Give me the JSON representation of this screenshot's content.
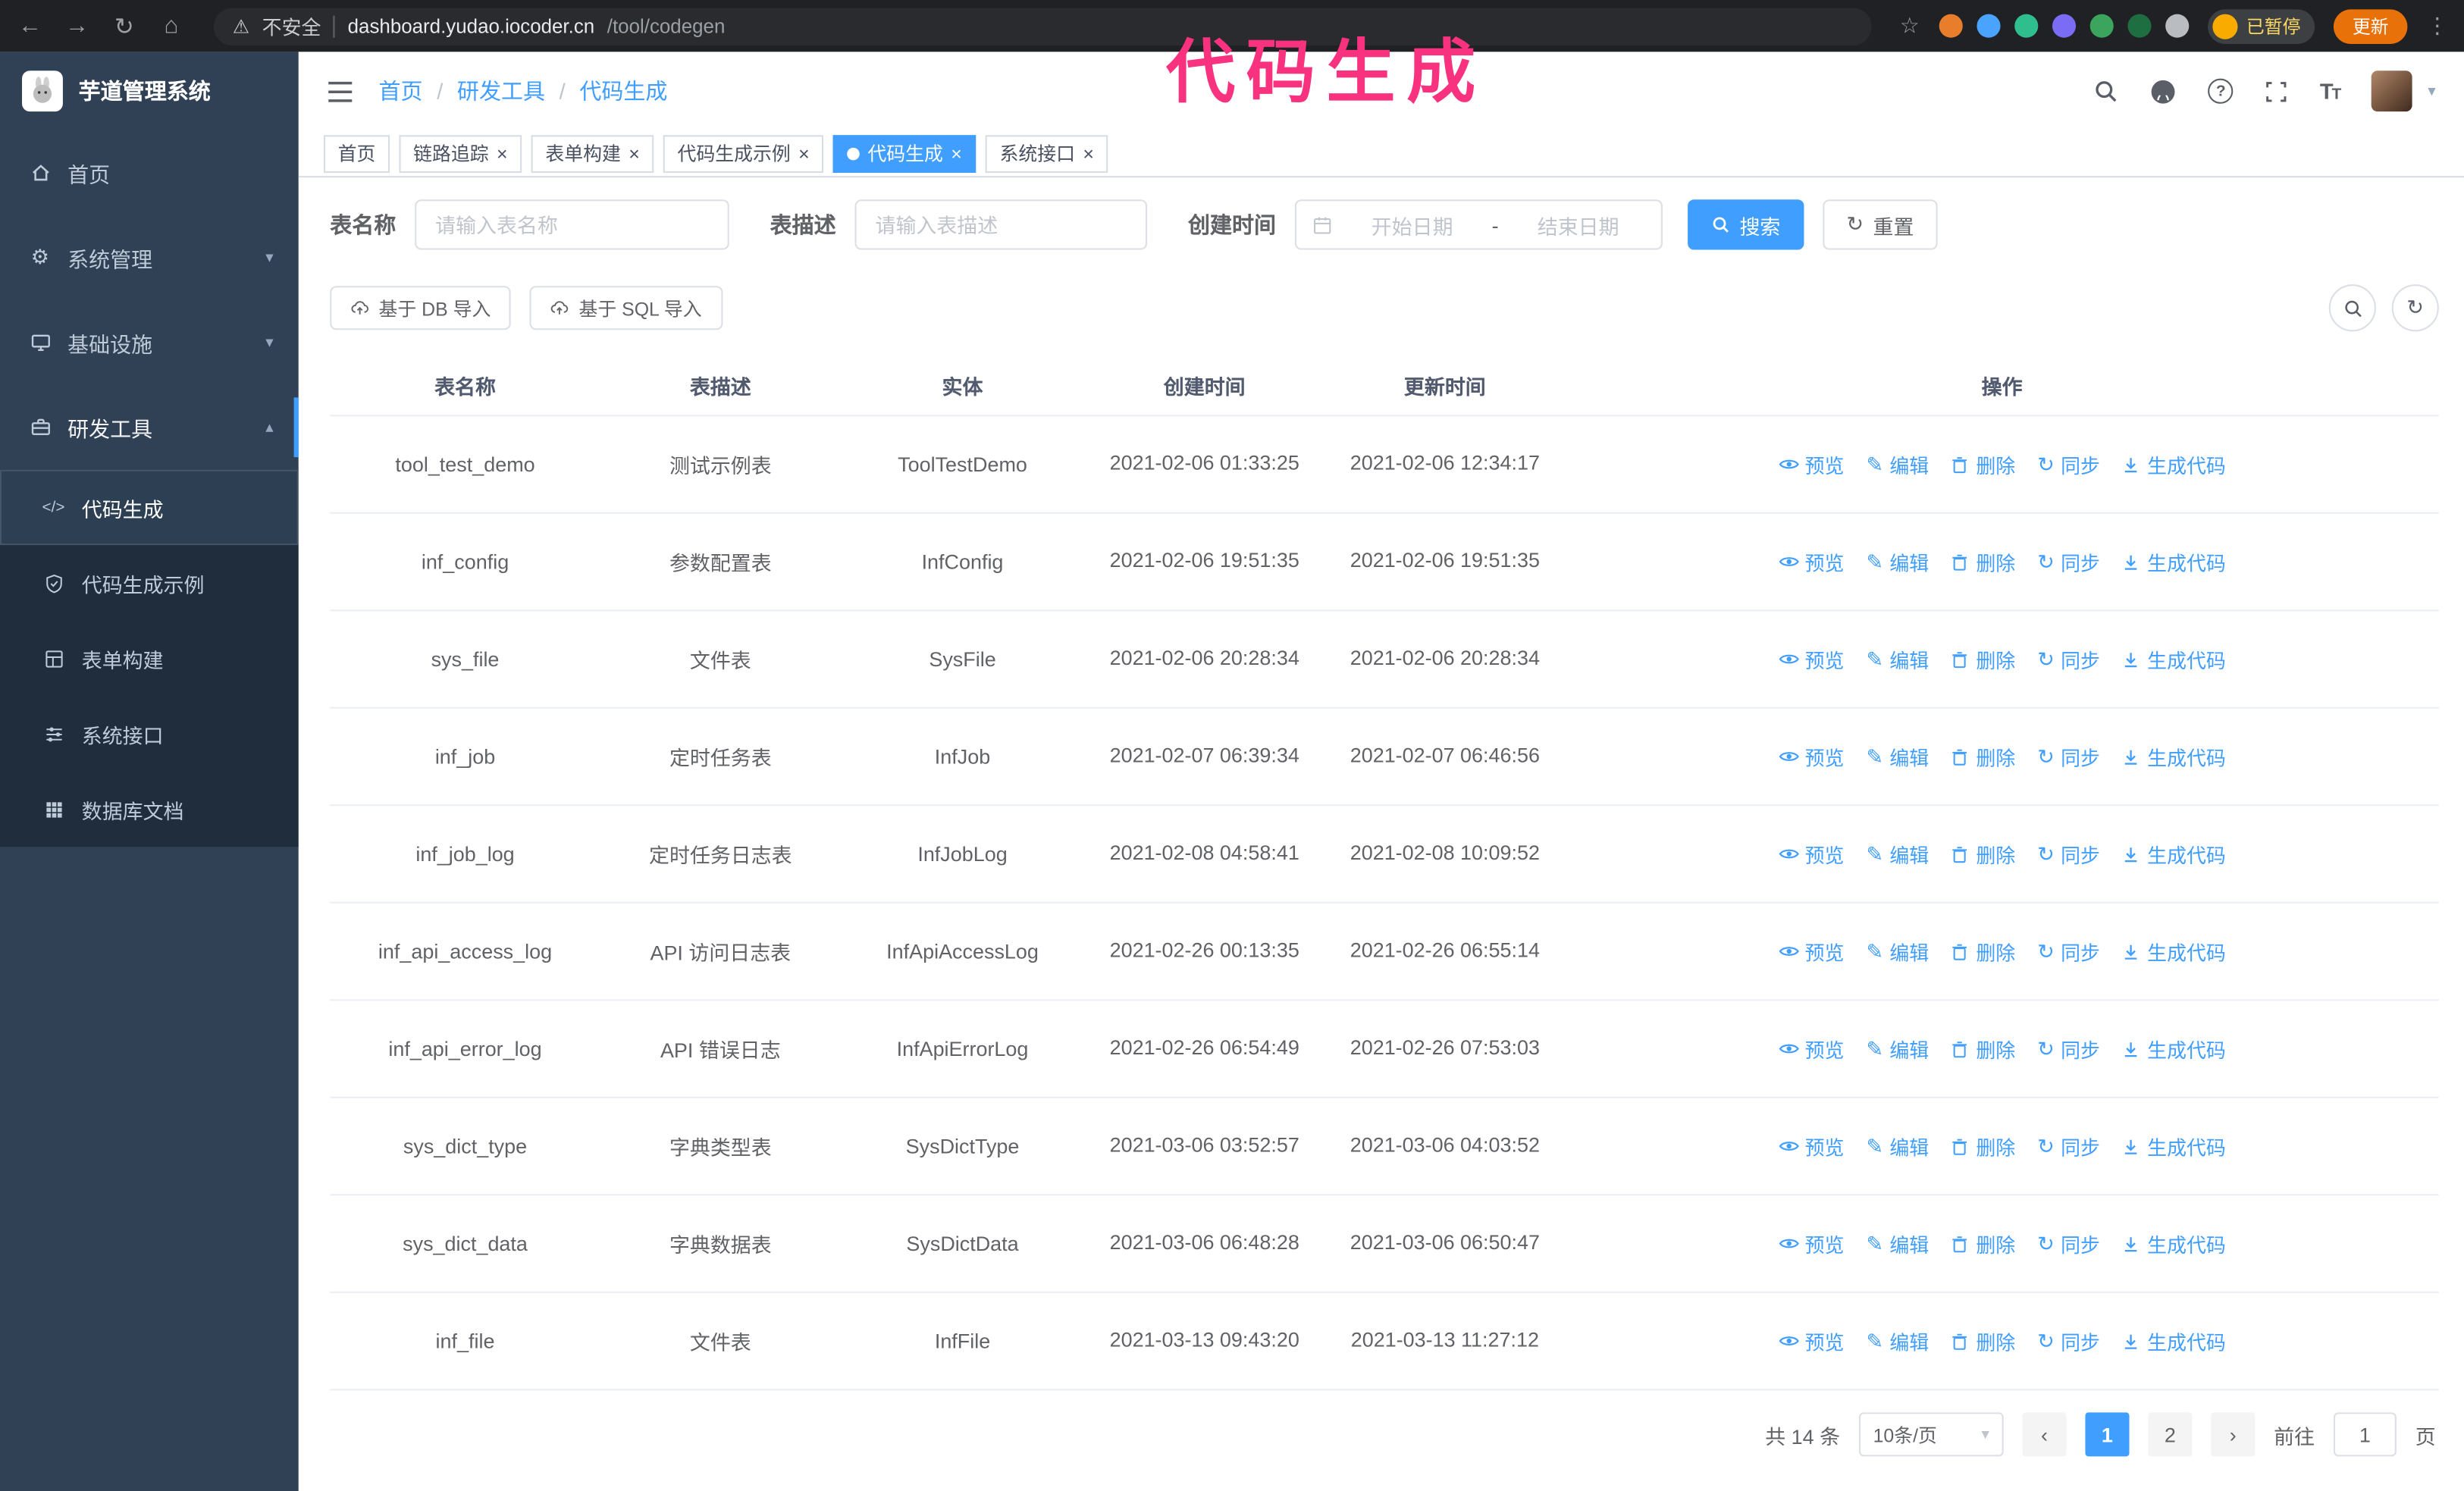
{
  "colors": {
    "accent": "#409eff",
    "annotation": "#f9327f",
    "sidebar": "#304156",
    "submenu": "#1f2d3d",
    "update_button": "#e8710a"
  },
  "annotation": {
    "text": "代码生成"
  },
  "browser": {
    "security_label": "不安全",
    "url_host": "dashboard.yudao.iocoder.cn",
    "url_path": "/tool/codegen",
    "profile_badge": "已暂停",
    "update_button": "更新",
    "extension_colors": [
      "#e87d2b",
      "#4aa3ff",
      "#2fbf8f",
      "#7b6cf6",
      "#3ba55d",
      "#1e6e42",
      "#b9bdc1"
    ]
  },
  "sidebar": {
    "app_title": "芋道管理系统",
    "items": [
      {
        "label": "首页"
      },
      {
        "label": "系统管理"
      },
      {
        "label": "基础设施"
      },
      {
        "label": "研发工具"
      }
    ],
    "submenu": [
      {
        "label": "代码生成",
        "active": true
      },
      {
        "label": "代码生成示例"
      },
      {
        "label": "表单构建"
      },
      {
        "label": "系统接口"
      },
      {
        "label": "数据库文档"
      }
    ]
  },
  "navbar": {
    "breadcrumb": [
      "首页",
      "研发工具",
      "代码生成"
    ]
  },
  "tabs": [
    {
      "label": "首页",
      "closable": false,
      "active": false
    },
    {
      "label": "链路追踪",
      "closable": true,
      "active": false
    },
    {
      "label": "表单构建",
      "closable": true,
      "active": false
    },
    {
      "label": "代码生成示例",
      "closable": true,
      "active": false
    },
    {
      "label": "代码生成",
      "closable": true,
      "active": true
    },
    {
      "label": "系统接口",
      "closable": true,
      "active": false
    }
  ],
  "filters": {
    "table_name_label": "表名称",
    "table_name_placeholder": "请输入表名称",
    "table_desc_label": "表描述",
    "table_desc_placeholder": "请输入表描述",
    "create_time_label": "创建时间",
    "date_start_placeholder": "开始日期",
    "date_separator": "-",
    "date_end_placeholder": "结束日期",
    "search_button": "搜索",
    "reset_button": "重置"
  },
  "toolbar": {
    "import_db": "基于 DB 导入",
    "import_sql": "基于 SQL 导入"
  },
  "table": {
    "columns": [
      "表名称",
      "表描述",
      "实体",
      "创建时间",
      "更新时间",
      "操作"
    ],
    "actions": [
      "预览",
      "编辑",
      "删除",
      "同步",
      "生成代码"
    ],
    "rows": [
      {
        "name": "tool_test_demo",
        "desc": "测试示例表",
        "entity": "ToolTestDemo",
        "created": "2021-02-06 01:33:25",
        "updated": "2021-02-06 12:34:17"
      },
      {
        "name": "inf_config",
        "desc": "参数配置表",
        "entity": "InfConfig",
        "created": "2021-02-06 19:51:35",
        "updated": "2021-02-06 19:51:35"
      },
      {
        "name": "sys_file",
        "desc": "文件表",
        "entity": "SysFile",
        "created": "2021-02-06 20:28:34",
        "updated": "2021-02-06 20:28:34"
      },
      {
        "name": "inf_job",
        "desc": "定时任务表",
        "entity": "InfJob",
        "created": "2021-02-07 06:39:34",
        "updated": "2021-02-07 06:46:56"
      },
      {
        "name": "inf_job_log",
        "desc": "定时任务日志表",
        "entity": "InfJobLog",
        "created": "2021-02-08 04:58:41",
        "updated": "2021-02-08 10:09:52"
      },
      {
        "name": "inf_api_access_log",
        "desc": "API 访问日志表",
        "entity": "InfApiAccessLog",
        "created": "2021-02-26 00:13:35",
        "updated": "2021-02-26 06:55:14"
      },
      {
        "name": "inf_api_error_log",
        "desc": "API 错误日志",
        "entity": "InfApiErrorLog",
        "created": "2021-02-26 06:54:49",
        "updated": "2021-02-26 07:53:03"
      },
      {
        "name": "sys_dict_type",
        "desc": "字典类型表",
        "entity": "SysDictType",
        "created": "2021-03-06 03:52:57",
        "updated": "2021-03-06 04:03:52"
      },
      {
        "name": "sys_dict_data",
        "desc": "字典数据表",
        "entity": "SysDictData",
        "created": "2021-03-06 06:48:28",
        "updated": "2021-03-06 06:50:47"
      },
      {
        "name": "inf_file",
        "desc": "文件表",
        "entity": "InfFile",
        "created": "2021-03-13 09:43:20",
        "updated": "2021-03-13 11:27:12"
      }
    ]
  },
  "pagination": {
    "total": "共 14 条",
    "page_size": "10条/页",
    "pages": [
      "1",
      "2"
    ],
    "active_page": "1",
    "goto_label": "前往",
    "goto_value": "1",
    "goto_suffix": "页"
  }
}
